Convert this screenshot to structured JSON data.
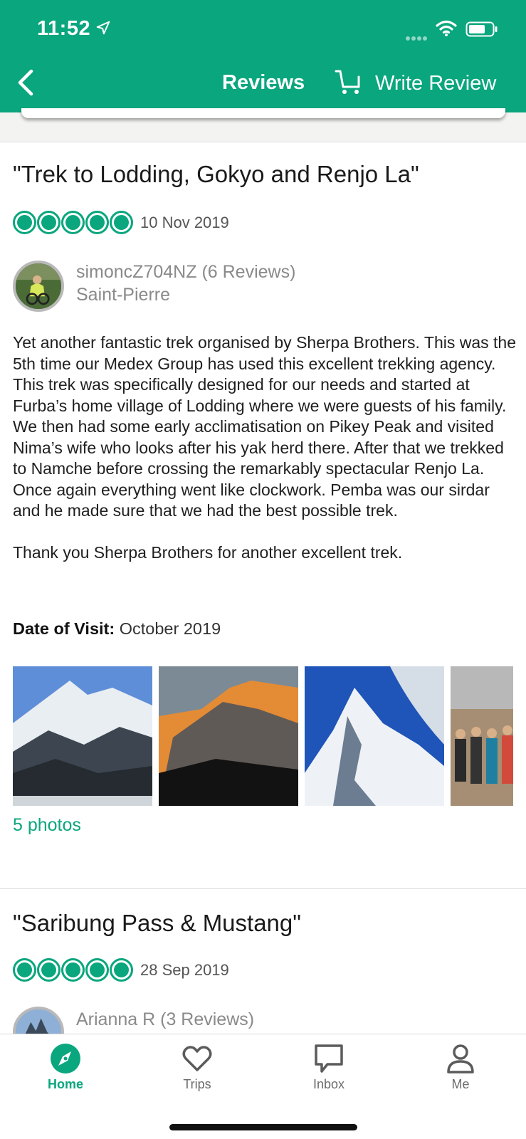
{
  "status_bar": {
    "time": "11:52"
  },
  "nav": {
    "title": "Reviews",
    "write_review": "Write Review"
  },
  "reviews": [
    {
      "title": "\"Trek to Lodding, Gokyo and Renjo La\"",
      "rating": 5,
      "date": "10 Nov 2019",
      "user": "simoncZ704NZ (6 Reviews)",
      "location": "Saint-Pierre",
      "body": "Yet another fantastic trek organised by Sherpa Brothers. This was the 5th time our Medex Group has used this excellent trekking agency. This trek was specifically designed for our needs and started at Furba’s home village of Lodding where we were guests of his family. We then had some early acclimatisation on Pikey Peak and visited Nima’s wife who looks after his yak herd there. After that we trekked to  Namche before crossing the remarkably spectacular Renjo La. Once again everything went like clockwork. Pemba was our sirdar and he made sure that we had the best possible trek.\n\nThank you Sherpa Brothers for another excellent trek.",
      "visit_label": "Date of Visit:",
      "visit_value": "October 2019",
      "photos_link": "5 photos"
    },
    {
      "title": "\"Saribung Pass & Mustang\"",
      "rating": 5,
      "date": "28 Sep 2019",
      "user": "Arianna R (3 Reviews)"
    }
  ],
  "tabs": [
    {
      "label": "Home",
      "icon": "compass-icon",
      "active": true
    },
    {
      "label": "Trips",
      "icon": "heart-icon",
      "active": false
    },
    {
      "label": "Inbox",
      "icon": "chat-icon",
      "active": false
    },
    {
      "label": "Me",
      "icon": "person-icon",
      "active": false
    }
  ],
  "colors": {
    "brand": "#0aa67e",
    "text": "#1a1a1a",
    "muted": "#8a8a8a"
  }
}
